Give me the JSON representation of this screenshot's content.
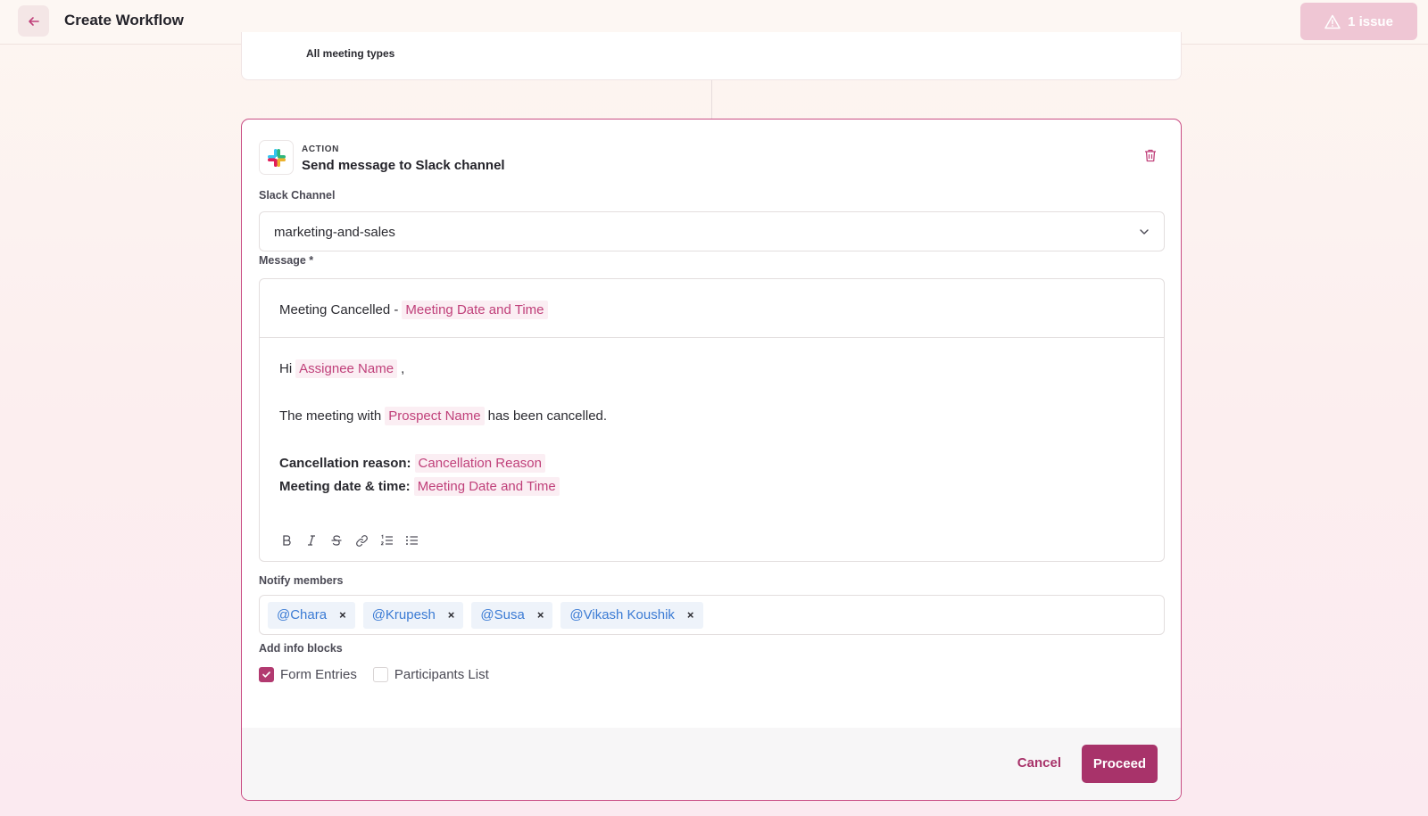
{
  "header": {
    "title": "Create Workflow",
    "issue_label": "1 issue"
  },
  "previous_step": {
    "text": "All meeting types"
  },
  "action": {
    "tag": "ACTION",
    "title": "Send message to Slack channel",
    "icon": "slack-logo"
  },
  "slack_channel": {
    "label": "Slack Channel",
    "value": "marketing-and-sales"
  },
  "message": {
    "label": "Message *",
    "subject_text": "Meeting Cancelled -",
    "subject_var": "Meeting Date and Time",
    "greeting": "Hi",
    "assignee_var": "Assignee Name",
    "greeting_comma": ",",
    "meeting_with": "The meeting with",
    "prospect_var": "Prospect Name",
    "has_been": "has been cancelled.",
    "reason_label": "Cancellation reason:",
    "reason_var": "Cancellation Reason",
    "date_label": "Meeting date & time:",
    "date_var": "Meeting Date and Time"
  },
  "toolbar": {
    "tools": [
      "bold-icon",
      "italic-icon",
      "strikethrough-icon",
      "link-icon",
      "ordered-list-icon",
      "bullet-list-icon"
    ]
  },
  "notify": {
    "label": "Notify members",
    "members": [
      "@Chara",
      "@Krupesh",
      "@Susa",
      "@Vikash Koushik"
    ],
    "remove_glyph": "×"
  },
  "info_blocks": {
    "label": "Add info blocks",
    "options": [
      {
        "label": "Form Entries",
        "checked": true
      },
      {
        "label": "Participants List",
        "checked": false
      }
    ]
  },
  "footer": {
    "cancel_label": "Cancel",
    "proceed_label": "Proceed"
  },
  "colors": {
    "accent": "#a8336a",
    "card_border": "#c94d84",
    "variable_text": "#c0407a",
    "chip_text": "#3b7bd4"
  }
}
